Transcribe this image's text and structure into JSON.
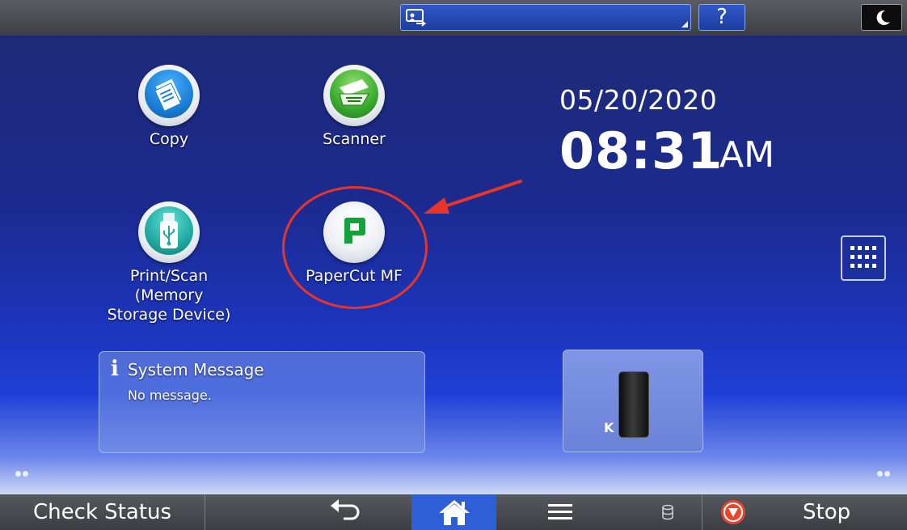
{
  "top_bar": {
    "source_icon": "screen-source-icon",
    "help_label": "?",
    "energy_icon": "moon-icon"
  },
  "apps": [
    {
      "label": "Copy",
      "icon": "copy-icon",
      "color": "#1a7fd6"
    },
    {
      "label": "Scanner",
      "icon": "scanner-icon",
      "color": "#39a92f"
    },
    {
      "label": "Print/Scan (Memory Storage Device)",
      "line1": "Print/Scan (Memory",
      "line2": "Storage Device)",
      "icon": "usb-icon",
      "color": "#1fa9a0"
    },
    {
      "label": "PaperCut MF",
      "icon": "papercut-icon",
      "color": "#14a33a"
    }
  ],
  "clock": {
    "date": "05/20/2020",
    "time": "08:31",
    "ampm": "AM"
  },
  "system_message": {
    "title": "System Message",
    "body": "No message."
  },
  "toner": {
    "label": "K",
    "color": "#111111"
  },
  "bottom_bar": {
    "check_status": "Check Status",
    "stop": "Stop",
    "home_color": "#2f5fd6"
  },
  "annotation": {
    "color": "#e8352a"
  }
}
